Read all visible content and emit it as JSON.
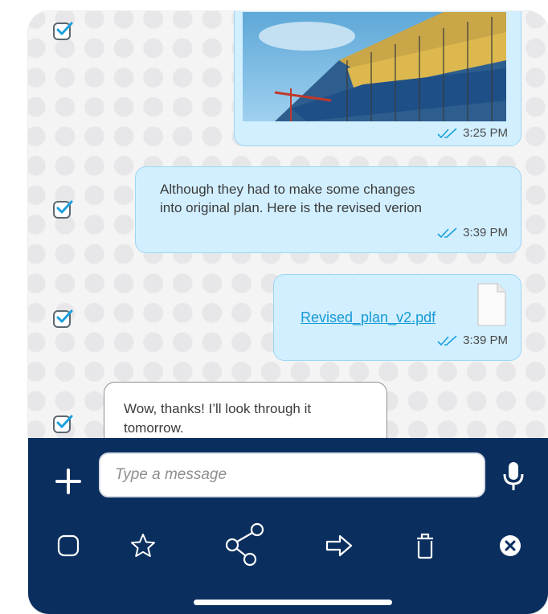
{
  "messages": [
    {
      "type": "image",
      "time": "3:25 PM",
      "status": "read"
    },
    {
      "type": "text",
      "lines": [
        "Although they had to make some changes",
        "into original plan. Here is the revised verion"
      ],
      "time": "3:39 PM",
      "status": "read"
    },
    {
      "type": "file",
      "file_name": "Revised_plan_v2.pdf",
      "time": "3:39 PM",
      "status": "read"
    },
    {
      "type": "incoming",
      "lines": [
        "Wow, thanks! I’ll look through it",
        "tomorrow."
      ]
    }
  ],
  "composer": {
    "placeholder": "Type a message",
    "value": ""
  },
  "toolbar": [
    "select-icon",
    "star-icon",
    "share-icon",
    "forward-icon",
    "delete-icon",
    "close-icon"
  ],
  "colors": {
    "outgoing_bubble": "#d2efff",
    "bar": "#0a2f5f",
    "accent": "#149ad6"
  }
}
